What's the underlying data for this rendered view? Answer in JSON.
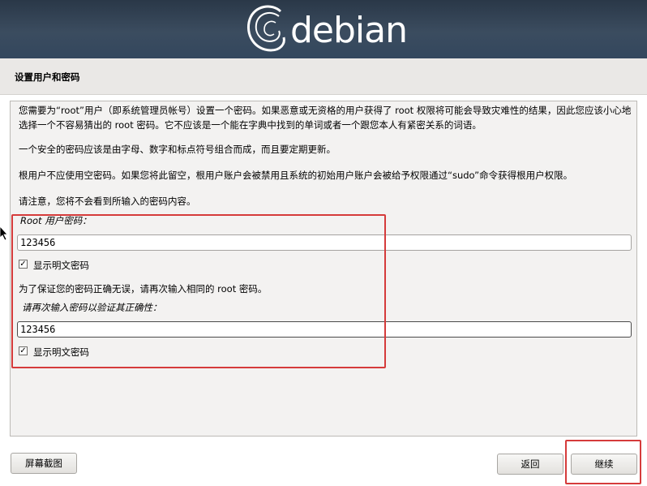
{
  "header": {
    "logo_text": "debian"
  },
  "page_title": "设置用户和密码",
  "intro": {
    "para1": "您需要为“root”用户（即系统管理员帐号）设置一个密码。如果恶意或无资格的用户获得了 root 权限将可能会导致灾难性的结果，因此您应该小心地选择一个不容易猜出的 root 密码。它不应该是一个能在字典中找到的单词或者一个跟您本人有紧密关系的词语。",
    "para2": "一个安全的密码应该是由字母、数字和标点符号组合而成，而且要定期更新。",
    "para3": "根用户不应使用空密码。如果您将此留空，根用户账户会被禁用且系统的初始用户账户会被给予权限通过“sudo”命令获得根用户权限。",
    "para4": "请注意，您将不会看到所输入的密码内容。"
  },
  "root_password": {
    "label": "Root 用户密码：",
    "value": "123456",
    "show_label": "显示明文密码",
    "show_checked": true
  },
  "verify_note": "为了保证您的密码正确无误，请再次输入相同的 root 密码。",
  "verify_password": {
    "label": "请再次输入密码以验证其正确性：",
    "value": "123456",
    "show_label": "显示明文密码",
    "show_checked": true
  },
  "buttons": {
    "screenshot": "屏幕截图",
    "back": "返回",
    "continue": "继续"
  },
  "colors": {
    "header_bg": "#2f3e50",
    "highlight": "#d53b3b",
    "panel_bg": "#f3f2f1"
  }
}
